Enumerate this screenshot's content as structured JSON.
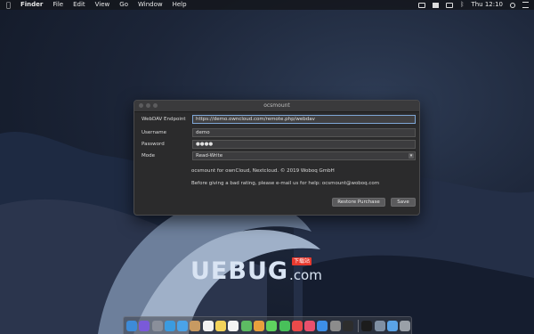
{
  "menubar": {
    "apple_icon": "apple-icon",
    "items": [
      "Finder",
      "File",
      "Edit",
      "View",
      "Go",
      "Window",
      "Help"
    ],
    "clock": "Thu 12:10"
  },
  "window": {
    "title": "ocsmount",
    "fields": {
      "endpoint_label": "WebDAV Endpoint",
      "endpoint_value": "https://demo.owncloud.com/remote.php/webdav",
      "username_label": "Username",
      "username_value": "demo",
      "password_label": "Password",
      "password_value": "●●●●",
      "mode_label": "Mode",
      "mode_value": "Read-Write"
    },
    "info_line_1": "ocsmount for ownCloud, Nextcloud. © 2019 Woboq GmbH",
    "info_line_2": "Before giving a bad rating, please e-mail us for help: ocsmount@woboq.com",
    "restore_button": "Restore Purchase",
    "save_button": "Save"
  },
  "watermark": {
    "main": "UEBUG",
    "suffix": ".com",
    "badge": "下载站"
  },
  "dock": {
    "apps": [
      {
        "name": "finder",
        "color": "#3d8bd8"
      },
      {
        "name": "siri",
        "color": "#7a5ad9"
      },
      {
        "name": "launchpad",
        "color": "#8a8f9a"
      },
      {
        "name": "safari",
        "color": "#3b9be0"
      },
      {
        "name": "mail",
        "color": "#4aa3e8"
      },
      {
        "name": "contacts",
        "color": "#c79a62"
      },
      {
        "name": "calendar",
        "color": "#f2f2f2"
      },
      {
        "name": "notes",
        "color": "#f3d35a"
      },
      {
        "name": "reminders",
        "color": "#f4f4f4"
      },
      {
        "name": "maps",
        "color": "#5dbb63"
      },
      {
        "name": "photos",
        "color": "#e8a03c"
      },
      {
        "name": "messages",
        "color": "#5fd25f"
      },
      {
        "name": "facetime",
        "color": "#48c05a"
      },
      {
        "name": "news",
        "color": "#e94a4a"
      },
      {
        "name": "itunes",
        "color": "#e9506d"
      },
      {
        "name": "app-store",
        "color": "#3d8fe8"
      },
      {
        "name": "system-preferences",
        "color": "#8c8c8c"
      },
      {
        "name": "activity-monitor",
        "color": "#2d2d2d"
      },
      {
        "name": "terminal",
        "color": "#1c1c1c"
      },
      {
        "name": "preview",
        "color": "#7f8fa3"
      },
      {
        "name": "folder",
        "color": "#5aa3e6"
      },
      {
        "name": "trash",
        "color": "#9aa0a8"
      }
    ]
  }
}
